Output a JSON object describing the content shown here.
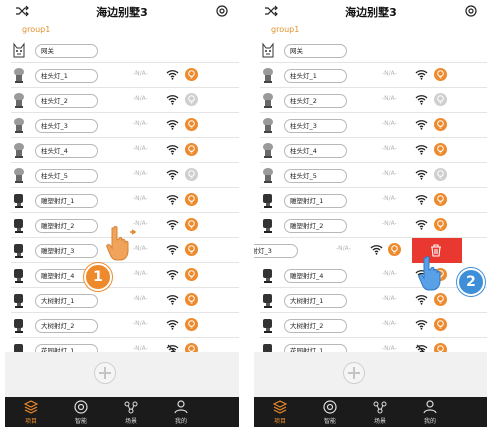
{
  "screens": [
    {
      "title": "海边别墅3",
      "group": "group1",
      "rows": [
        {
          "icon": "gateway",
          "name": "网关",
          "status": "",
          "wifi": "",
          "bulb": ""
        },
        {
          "icon": "light",
          "name": "柱头灯_1",
          "status": "-N/A-",
          "wifi": "on",
          "bulb": "on"
        },
        {
          "icon": "light",
          "name": "柱头灯_2",
          "status": "-N/A-",
          "wifi": "on",
          "bulb": "off"
        },
        {
          "icon": "light",
          "name": "柱头灯_3",
          "status": "-N/A-",
          "wifi": "on",
          "bulb": "on"
        },
        {
          "icon": "light",
          "name": "柱头灯_4",
          "status": "-N/A-",
          "wifi": "on",
          "bulb": "on"
        },
        {
          "icon": "light",
          "name": "柱头灯_5",
          "status": "-N/A-",
          "wifi": "on",
          "bulb": "off"
        },
        {
          "icon": "spot",
          "name": "雕塑射灯_1",
          "status": "-N/A-",
          "wifi": "on",
          "bulb": "on"
        },
        {
          "icon": "spot",
          "name": "雕塑射灯_2",
          "status": "-N/A-",
          "wifi": "on",
          "bulb": "on"
        },
        {
          "icon": "spot",
          "name": "雕塑射灯_3",
          "status": "-N/A-",
          "wifi": "on",
          "bulb": "on"
        },
        {
          "icon": "spot",
          "name": "雕塑射灯_4",
          "status": "-N/A-",
          "wifi": "on",
          "bulb": "on"
        },
        {
          "icon": "spot",
          "name": "大树射灯_1",
          "status": "-N/A-",
          "wifi": "on",
          "bulb": "on"
        },
        {
          "icon": "spot",
          "name": "大树射灯_2",
          "status": "-N/A-",
          "wifi": "on",
          "bulb": "on"
        },
        {
          "icon": "spot",
          "name": "花园射灯_1",
          "status": "-N/A-",
          "wifi": "off",
          "bulb": "on"
        }
      ],
      "tabs": [
        {
          "label": "项目",
          "icon": "layers-icon",
          "active": true
        },
        {
          "label": "智能",
          "icon": "smart-icon",
          "active": false
        },
        {
          "label": "场景",
          "icon": "scene-icon",
          "active": false
        },
        {
          "label": "我的",
          "icon": "profile-icon",
          "active": false
        }
      ],
      "step_badge": "1"
    },
    {
      "title": "海边别墅3",
      "group": "group1",
      "rows": [
        {
          "icon": "gateway",
          "name": "网关",
          "status": "",
          "wifi": "",
          "bulb": ""
        },
        {
          "icon": "light",
          "name": "柱头灯_1",
          "status": "-N/A-",
          "wifi": "on",
          "bulb": "on"
        },
        {
          "icon": "light",
          "name": "柱头灯_2",
          "status": "-N/A-",
          "wifi": "on",
          "bulb": "off"
        },
        {
          "icon": "light",
          "name": "柱头灯_3",
          "status": "-N/A-",
          "wifi": "on",
          "bulb": "on"
        },
        {
          "icon": "light",
          "name": "柱头灯_4",
          "status": "-N/A-",
          "wifi": "on",
          "bulb": "on"
        },
        {
          "icon": "light",
          "name": "柱头灯_5",
          "status": "-N/A-",
          "wifi": "on",
          "bulb": "off"
        },
        {
          "icon": "spot",
          "name": "雕塑射灯_1",
          "status": "-N/A-",
          "wifi": "on",
          "bulb": "on"
        },
        {
          "icon": "spot",
          "name": "雕塑射灯_2",
          "status": "-N/A-",
          "wifi": "on",
          "bulb": "on"
        },
        {
          "swiped": true,
          "name": "塑射灯_3",
          "status": "-N/A-",
          "wifi": "on",
          "bulb": "on",
          "action": "delete"
        },
        {
          "icon": "spot",
          "name": "雕塑射灯_4",
          "status": "-N/A-",
          "wifi": "on",
          "bulb": "on"
        },
        {
          "icon": "spot",
          "name": "大树射灯_1",
          "status": "-N/A-",
          "wifi": "on",
          "bulb": "on"
        },
        {
          "icon": "spot",
          "name": "大树射灯_2",
          "status": "-N/A-",
          "wifi": "on",
          "bulb": "on"
        },
        {
          "icon": "spot",
          "name": "花园射灯_1",
          "status": "-N/A-",
          "wifi": "off",
          "bulb": "on"
        }
      ],
      "tabs": [
        {
          "label": "项目",
          "icon": "layers-icon",
          "active": true
        },
        {
          "label": "智能",
          "icon": "smart-icon",
          "active": false
        },
        {
          "label": "场景",
          "icon": "scene-icon",
          "active": false
        },
        {
          "label": "我的",
          "icon": "profile-icon",
          "active": false
        }
      ],
      "step_badge": "2"
    }
  ],
  "colors": {
    "accent": "#ee8a2b",
    "delete": "#e8382f",
    "tabbar": "#1b1b1b",
    "step2": "#3f8ed8"
  }
}
